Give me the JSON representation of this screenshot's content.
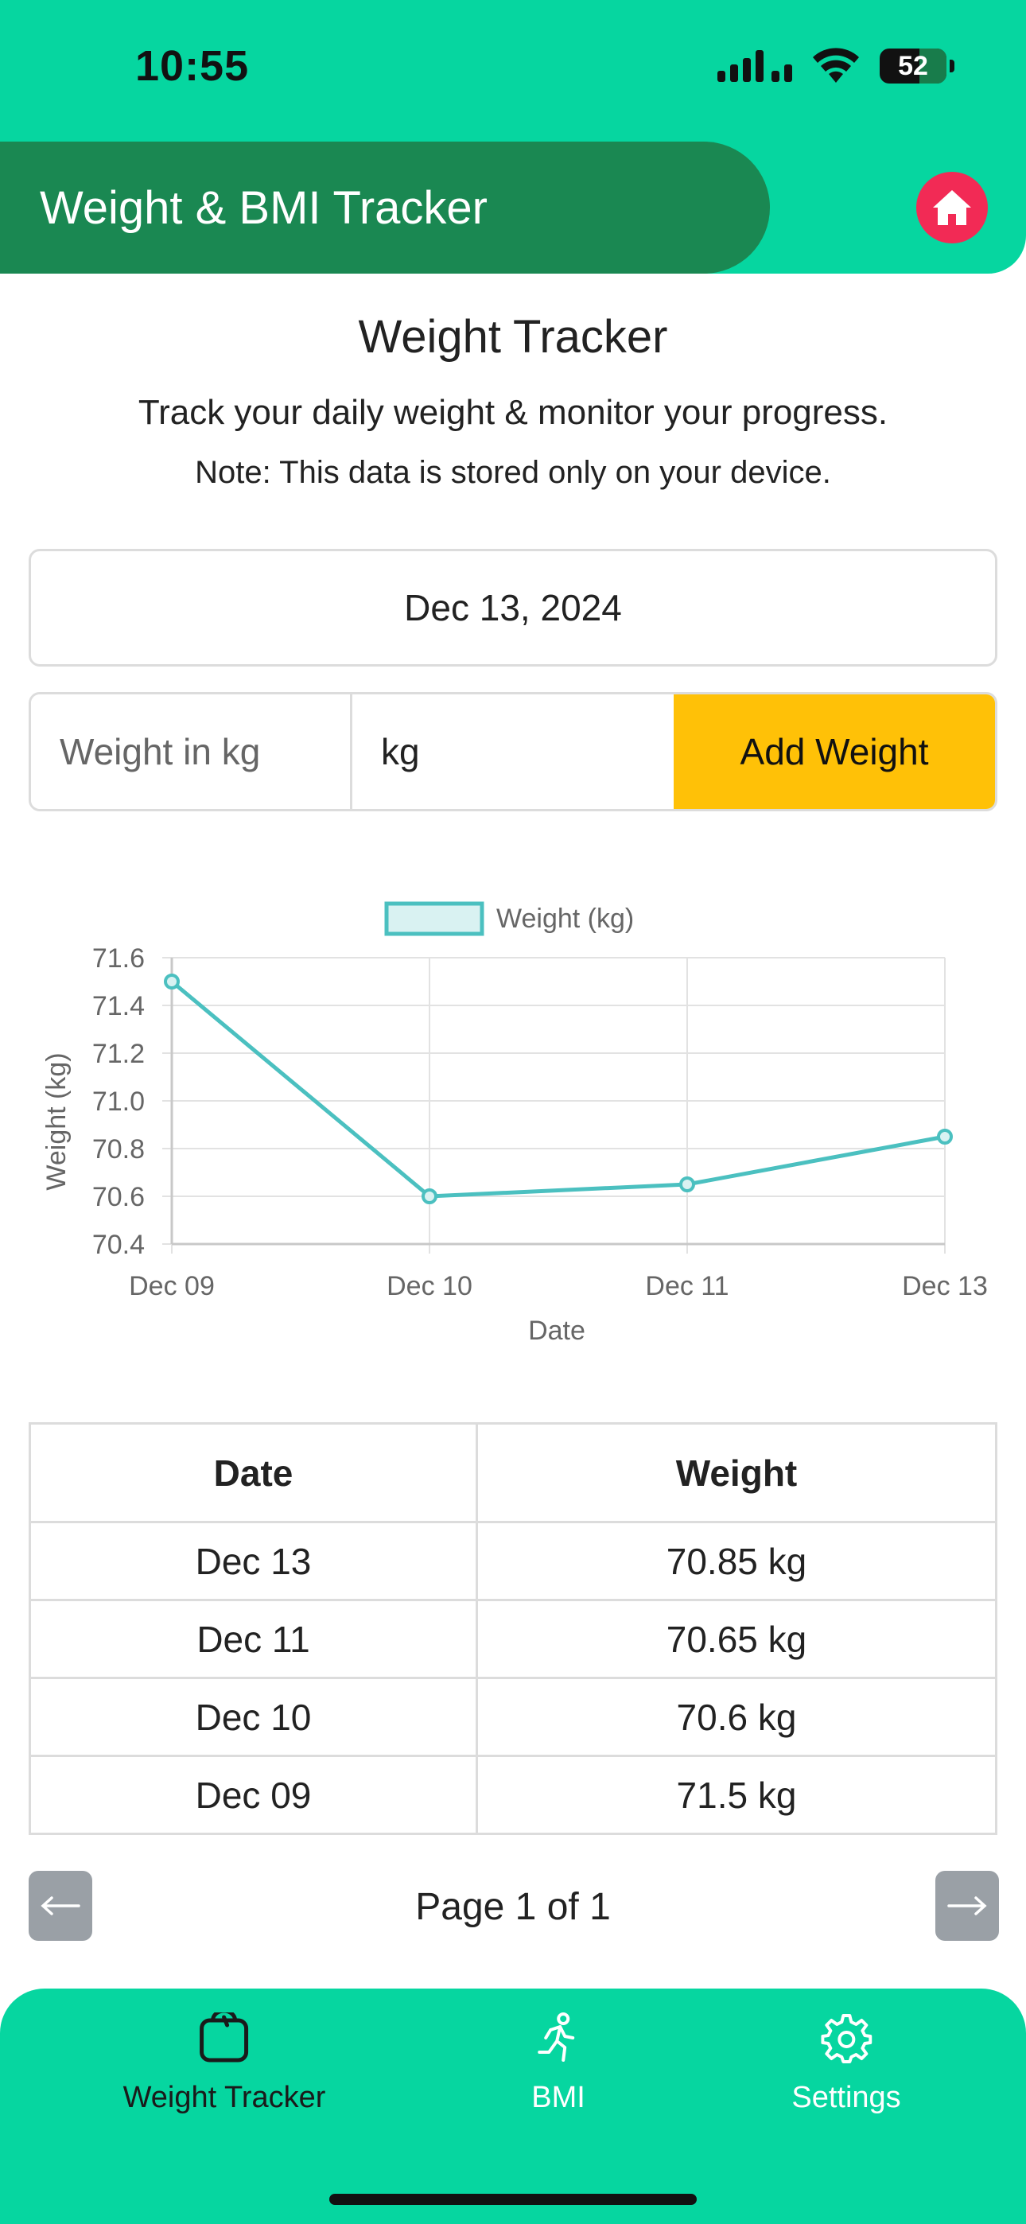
{
  "status": {
    "time": "10:55",
    "battery": "52"
  },
  "header": {
    "title": "Weight & BMI Tracker"
  },
  "main": {
    "title": "Weight Tracker",
    "subtitle": "Track your daily weight & monitor your progress.",
    "note": "Note: This data is stored only on your device.",
    "date_value": "Dec 13, 2024",
    "weight_placeholder": "Weight in kg",
    "unit": "kg",
    "add_label": "Add Weight"
  },
  "chart_data": {
    "type": "line",
    "categories": [
      "Dec 09",
      "Dec 10",
      "Dec 11",
      "Dec 13"
    ],
    "series": [
      {
        "name": "Weight (kg)",
        "values": [
          71.5,
          70.6,
          70.65,
          70.85
        ]
      }
    ],
    "xlabel": "Date",
    "ylabel": "Weight (kg)",
    "ylim": [
      70.4,
      71.6
    ],
    "yticks": [
      "71.6",
      "71.4",
      "71.2",
      "71.0",
      "70.8",
      "70.6",
      "70.4"
    ],
    "grid": true,
    "legend": "top-center",
    "color": "#4BC0C0"
  },
  "table": {
    "headers": [
      "Date",
      "Weight"
    ],
    "rows": [
      [
        "Dec 13",
        "70.85 kg"
      ],
      [
        "Dec 11",
        "70.65 kg"
      ],
      [
        "Dec 10",
        "70.6 kg"
      ],
      [
        "Dec 09",
        "71.5 kg"
      ]
    ]
  },
  "pagination": {
    "label": "Page 1 of 1"
  },
  "nav": {
    "weight": "Weight Tracker",
    "bmi": "BMI",
    "settings": "Settings"
  }
}
